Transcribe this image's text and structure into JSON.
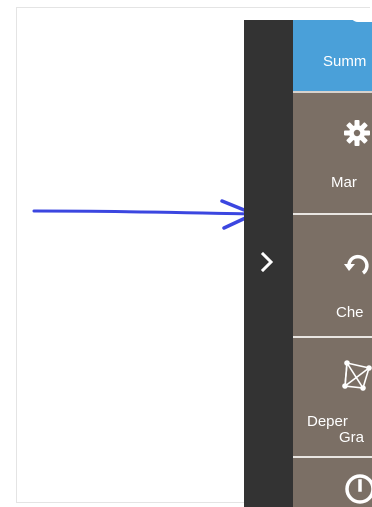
{
  "sidebar": {
    "toggle_icon": "chevron-right-icon",
    "items": [
      {
        "label": "Summ",
        "icon": "",
        "active": true
      },
      {
        "label": "Mar",
        "icon": "gear-icon",
        "active": false
      },
      {
        "label": "Che",
        "icon": "undo-arrow-icon",
        "active": false
      },
      {
        "label_line1": "Deper",
        "label_line2": "Gra",
        "icon": "network-graph-icon",
        "active": false
      },
      {
        "label": "",
        "icon": "clock-icon",
        "active": false
      }
    ]
  },
  "annotation": {
    "arrow_color": "#3b46e0"
  },
  "colors": {
    "strip": "#333333",
    "nav_bg": "#7b6f65",
    "active_bg": "#4aa0d9",
    "divider": "#e9e6e2"
  }
}
